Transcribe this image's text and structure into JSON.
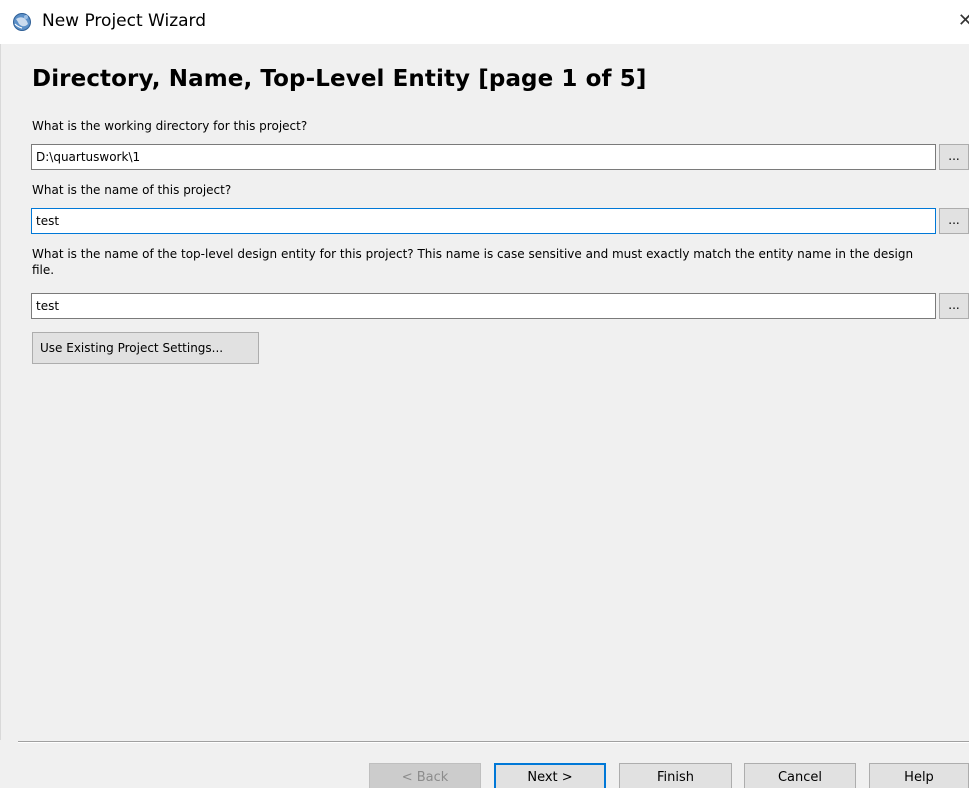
{
  "window": {
    "title": "New Project Wizard",
    "close_glyph": "✕"
  },
  "page": {
    "heading": "Directory, Name, Top-Level Entity [page 1 of 5]"
  },
  "fields": {
    "directory": {
      "label": "What is the working directory for this project?",
      "value": "D:\\quartuswork\\1",
      "browse_label": "..."
    },
    "project_name": {
      "label": "What is the name of this project?",
      "value": "test",
      "browse_label": "..."
    },
    "top_level": {
      "label": "What is the name of the top-level design entity for this project? This name is case sensitive and must exactly match the entity name in the design file.",
      "value": "test",
      "browse_label": "..."
    }
  },
  "buttons": {
    "existing_settings": "Use Existing Project Settings...",
    "back": "< Back",
    "next": "Next >",
    "finish": "Finish",
    "cancel": "Cancel",
    "help": "Help"
  },
  "icons": {
    "app": "quartus-globe-icon"
  },
  "colors": {
    "focus_border": "#0078d7",
    "window_bg": "#f0f0f0"
  }
}
